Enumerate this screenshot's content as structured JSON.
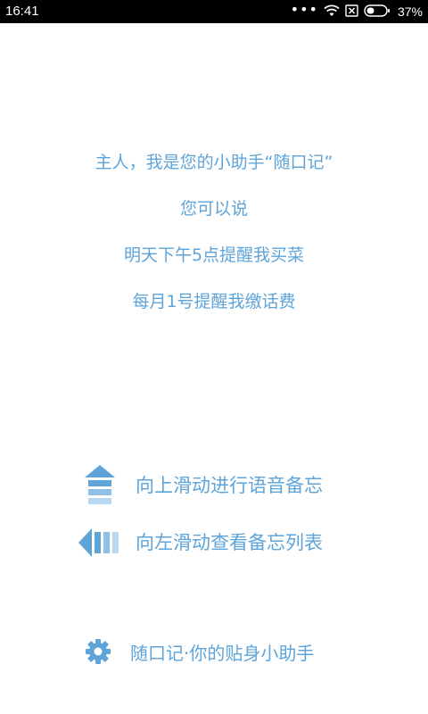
{
  "status_bar": {
    "time": "16:41",
    "dots": "•••",
    "battery_text": "37%"
  },
  "intro": {
    "line1": "主人，我是您的小助手“随口记”",
    "line2": "您可以说",
    "line3": "明天下午5点提醒我买菜",
    "line4": "每月1号提醒我缴话费"
  },
  "hints": {
    "swipe_up": "向上滑动进行语音备忘",
    "swipe_left": "向左滑动查看备忘列表"
  },
  "footer": {
    "text": "随口记·你的贴身小助手"
  },
  "colors": {
    "accent": "#5fa4d8",
    "accent_light": "#b9d9f2"
  }
}
